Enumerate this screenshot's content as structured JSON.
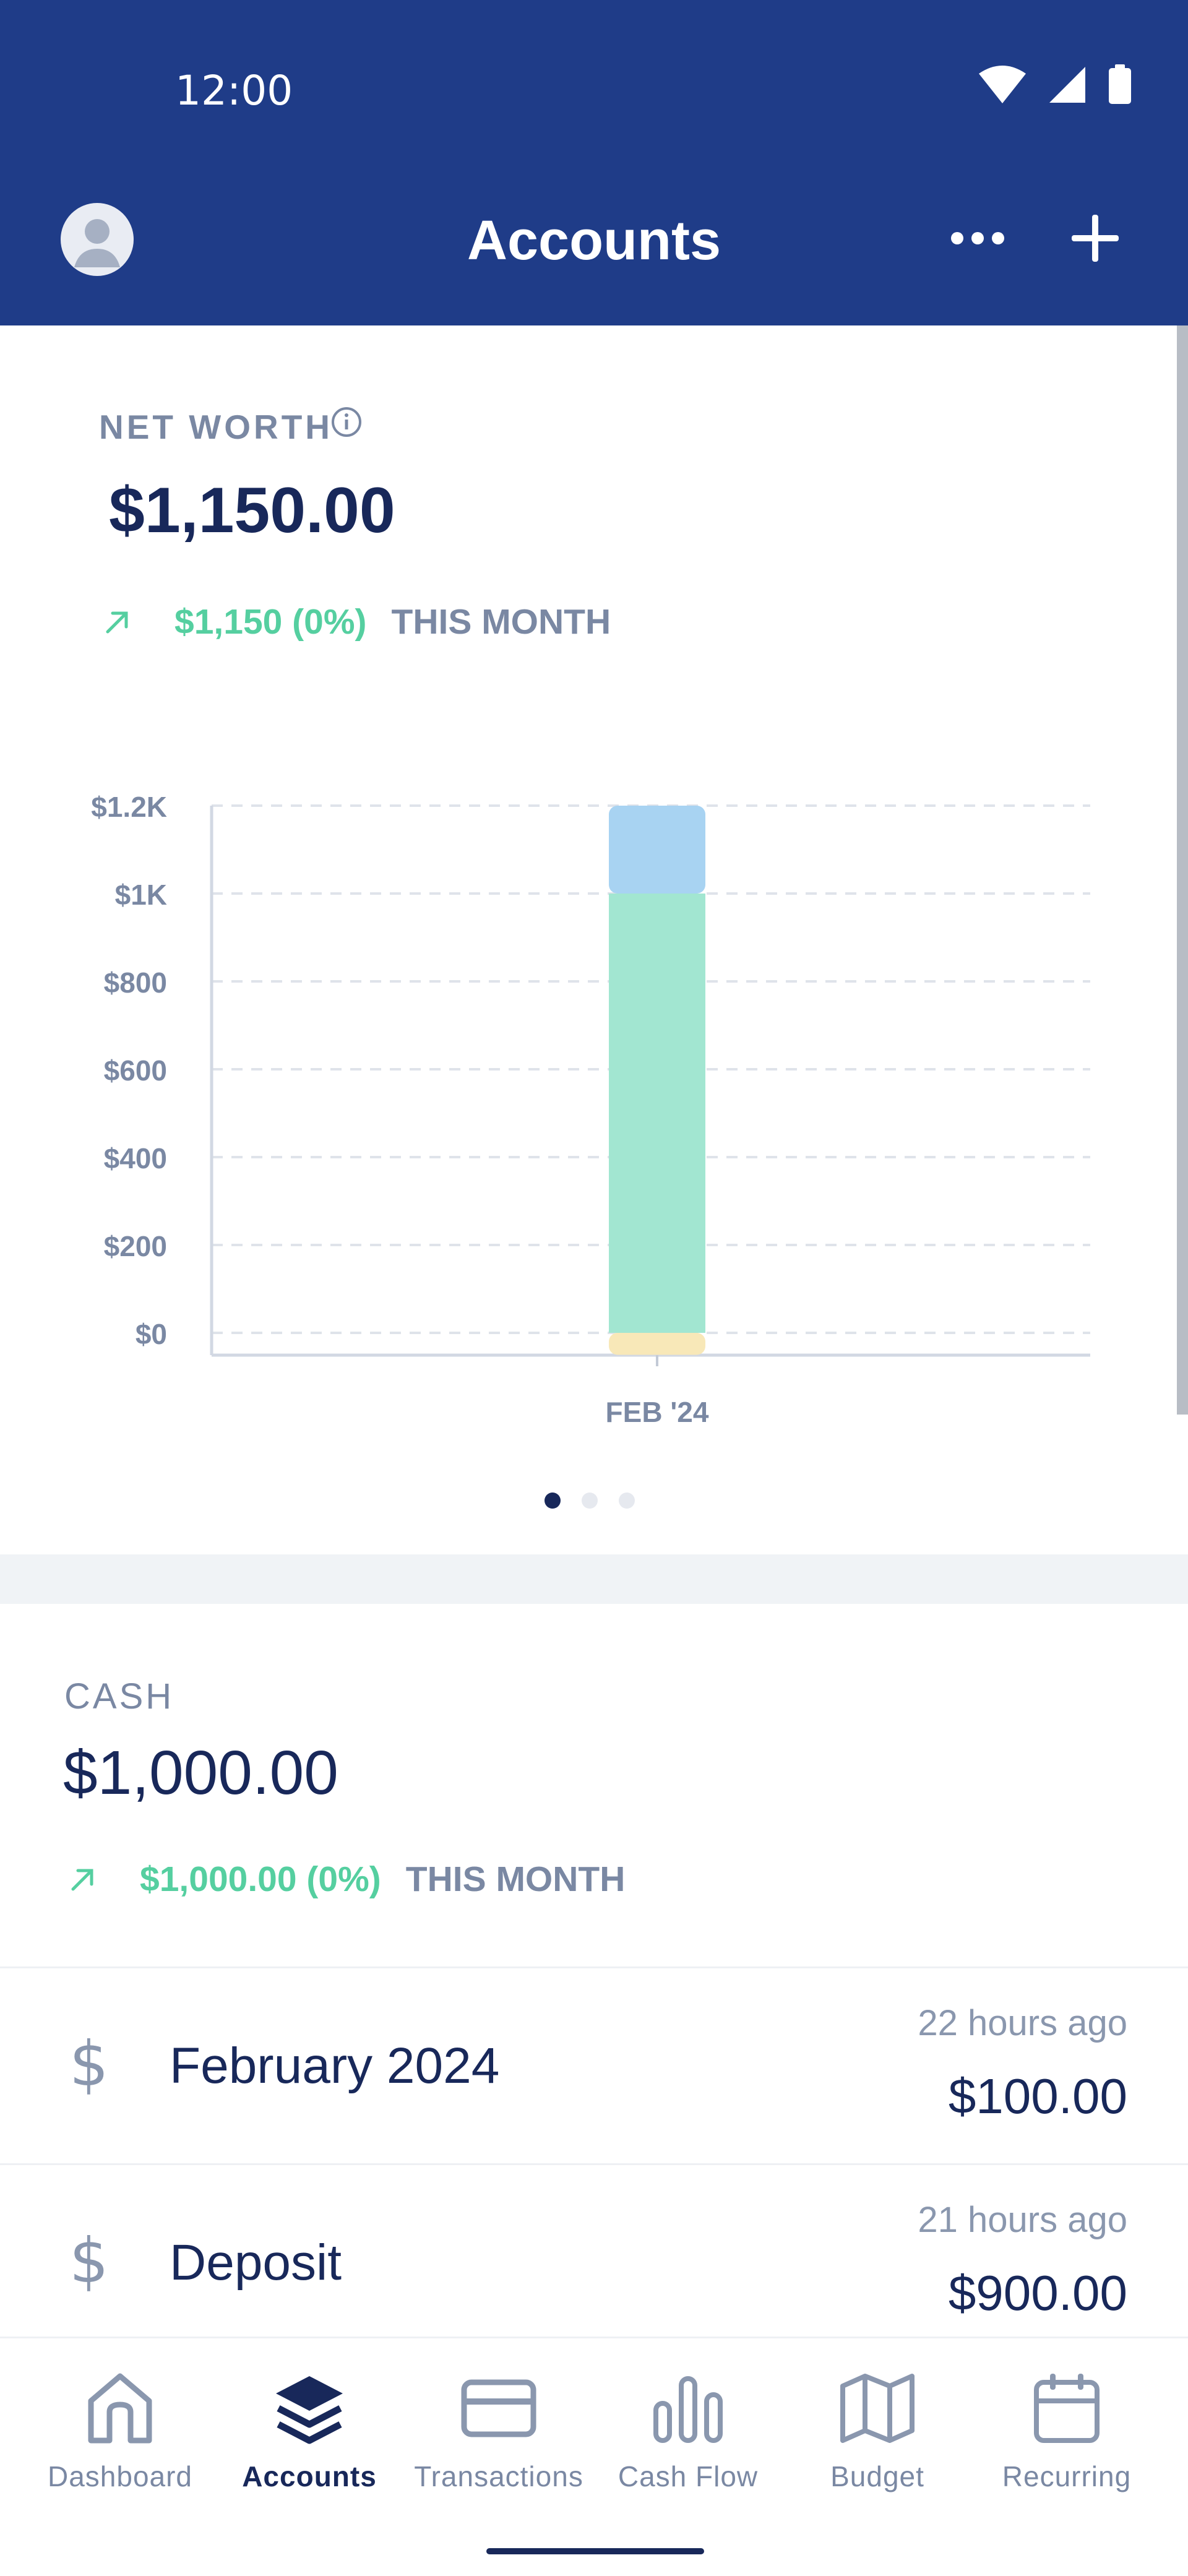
{
  "status_bar": {
    "time": "12:00"
  },
  "header": {
    "title": "Accounts"
  },
  "net_worth": {
    "label": "NET WORTH",
    "value": "$1,150.00",
    "change_amount": "$1,150 (0%)",
    "change_period": "THIS MONTH"
  },
  "chart_data": {
    "type": "bar",
    "categories": [
      "FEB '24"
    ],
    "series": [
      {
        "values": [
          -50
        ],
        "color": "#f8e8b8"
      },
      {
        "values": [
          1000
        ],
        "color": "#a2e6d1"
      },
      {
        "values": [
          200
        ],
        "color": "#a8d3f2"
      }
    ],
    "y_ticks": [
      "$1.2K",
      "$1K",
      "$800",
      "$600",
      "$400",
      "$200",
      "$0"
    ],
    "ylim": [
      -50,
      1200
    ],
    "grid": true
  },
  "carousel": {
    "pages": 3,
    "active": 0
  },
  "cash": {
    "label": "CASH",
    "value": "$1,000.00",
    "change_amount": "$1,000.00 (0%)",
    "change_period": "THIS MONTH",
    "items": [
      {
        "title": "February 2024",
        "time": "22 hours ago",
        "amount": "$100.00",
        "icon": "dollar-icon"
      },
      {
        "title": "Deposit",
        "time": "21 hours ago",
        "amount": "$900.00",
        "icon": "dollar-icon"
      }
    ]
  },
  "bottom_nav": {
    "items": [
      {
        "label": "Dashboard",
        "icon": "home-icon",
        "active": false
      },
      {
        "label": "Accounts",
        "icon": "layers-icon",
        "active": true
      },
      {
        "label": "Transactions",
        "icon": "card-icon",
        "active": false
      },
      {
        "label": "Cash Flow",
        "icon": "bar-chart-icon",
        "active": false
      },
      {
        "label": "Budget",
        "icon": "map-icon",
        "active": false
      },
      {
        "label": "Recurring",
        "icon": "calendar-icon",
        "active": false
      }
    ]
  },
  "colors": {
    "header_bg": "#1f3c88",
    "positive": "#55cfa0",
    "text_primary": "#18285a",
    "text_muted": "#7a88a3"
  }
}
